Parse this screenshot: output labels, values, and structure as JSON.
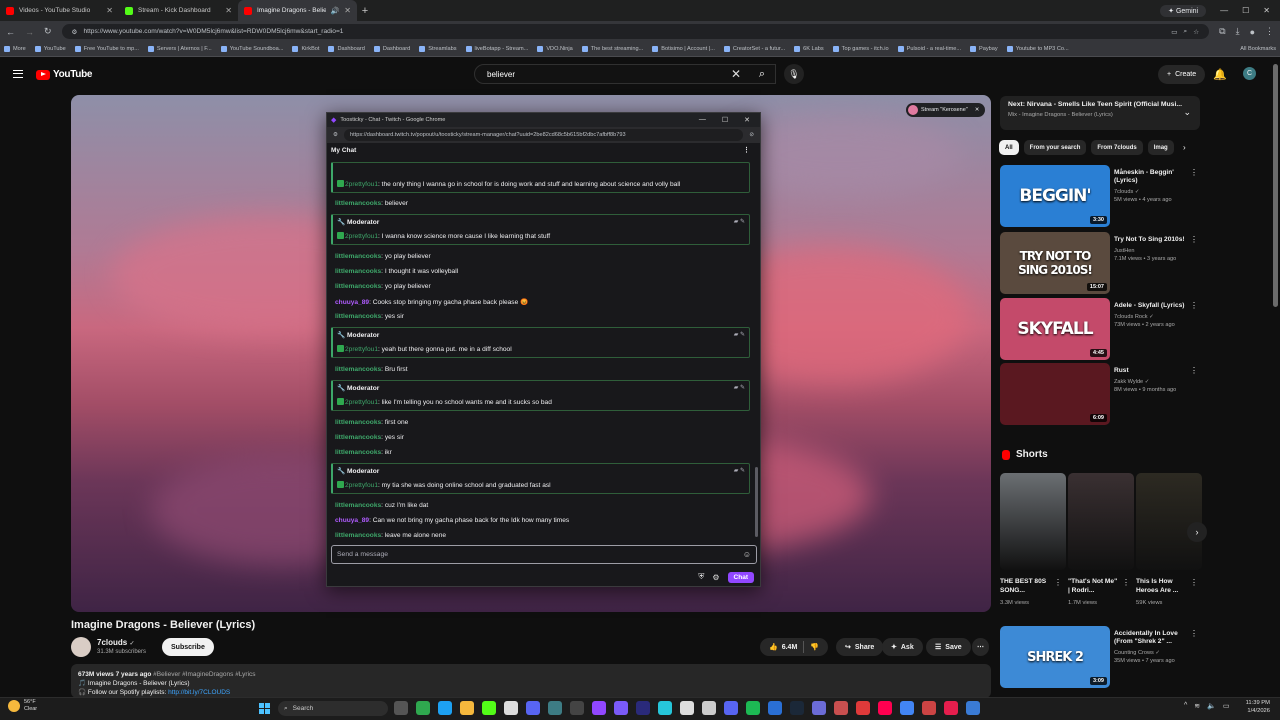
{
  "browser": {
    "tabs": [
      {
        "title": "Videos - YouTube Studio",
        "color": "#ff0000"
      },
      {
        "title": "Stream - Kick Dashboard",
        "color": "#53fc18"
      },
      {
        "title": "Imagine Dragons - Believer",
        "color": "#ff0000"
      }
    ],
    "gemini_label": "Gemini",
    "url": "https://www.youtube.com/watch?v=W0DM5lcj6mw&list=RDW0DM5lcj6mw&start_radio=1",
    "bookmarks": [
      "More",
      "YouTube",
      "Free YouTube to mp...",
      "Servers | Aternos | F...",
      "YouTube Soundboa...",
      "KirkBot",
      "Dashboard",
      "Dashboard",
      "Streamlabs",
      "liveBotapp - Stream...",
      "VDO.Ninja",
      "The best streaming...",
      "Botisimo | Account |...",
      "CreatorSet - a futur...",
      "6K Labs",
      "Top games - itch.io",
      "Pulsoid - a real-time...",
      "Paybay",
      "Youtube to MP3 Co..."
    ],
    "all_bookmarks": "All Bookmarks"
  },
  "youtube": {
    "logo": "YouTube",
    "search_value": "believer",
    "create_label": "Create",
    "avatar_letter": "C"
  },
  "stream_chip": "Stream \"Kerosene\"",
  "popup": {
    "title": "Toosticky - Chat - Twitch - Google Chrome",
    "url": "https://dashboard.twitch.tv/popout/u/toosticky/stream-manager/chat?uuid=2be82cd68c5b615bf2dbc7afbff8b793",
    "header": "My Chat",
    "mod_label": "Moderator",
    "send_placeholder": "Send a message",
    "chat_button": "Chat",
    "messages": [
      {
        "kind": "mod_cont",
        "user": "2prettyfou1",
        "text": ": the only thing I wanna go in school for is doing work and stuff and learning about science and volly ball"
      },
      {
        "kind": "msg",
        "user": "littlemancooks",
        "text": ": believer",
        "ucolor": "#3ea76a"
      },
      {
        "kind": "mod",
        "user": "2prettyfou1",
        "text": ": I wanna know science more cause I like learning that stuff"
      },
      {
        "kind": "msg",
        "user": "littlemancooks",
        "text": ": yo play believer",
        "ucolor": "#3ea76a"
      },
      {
        "kind": "msg",
        "user": "littlemancooks",
        "text": ": I thought it was volleyball",
        "ucolor": "#3ea76a"
      },
      {
        "kind": "msg",
        "user": "littlemancooks",
        "text": ": yo play believer",
        "ucolor": "#3ea76a"
      },
      {
        "kind": "msg",
        "user": "chuuya_89",
        "text": ": Cooks stop bringing my gacha phase back please 😡",
        "ucolor": "#b05cff"
      },
      {
        "kind": "msg",
        "user": "littlemancooks",
        "text": ": yes sir",
        "ucolor": "#3ea76a"
      },
      {
        "kind": "mod",
        "user": "2prettyfou1",
        "text": ": yeah but there gonna put. me in a diff school"
      },
      {
        "kind": "msg",
        "user": "littlemancooks",
        "text": ": Bru first",
        "ucolor": "#3ea76a"
      },
      {
        "kind": "mod",
        "user": "2prettyfou1",
        "text": ": like I'm telling you no school wants me and it sucks so bad"
      },
      {
        "kind": "msg",
        "user": "littlemancooks",
        "text": ": first one",
        "ucolor": "#3ea76a"
      },
      {
        "kind": "msg",
        "user": "littlemancooks",
        "text": ": yes sir",
        "ucolor": "#3ea76a"
      },
      {
        "kind": "msg",
        "user": "littlemancooks",
        "text": ": ikr",
        "ucolor": "#3ea76a"
      },
      {
        "kind": "mod",
        "user": "2prettyfou1",
        "text": ": my tia she was doing online school and graduated fast asl"
      },
      {
        "kind": "msg",
        "user": "littlemancooks",
        "text": ": cuz I'm like dat",
        "ucolor": "#3ea76a"
      },
      {
        "kind": "msg",
        "user": "chuuya_89",
        "text": ": Can we not bring my gacha phase back for the Idk how many times",
        "ucolor": "#b05cff"
      },
      {
        "kind": "msg",
        "user": "littlemancooks",
        "text": ": leave me alone nene",
        "ucolor": "#3ea76a"
      }
    ]
  },
  "video": {
    "title": "Imagine Dragons - Believer (Lyrics)",
    "channel": "7clouds",
    "subscribers": "31.3M subscribers",
    "subscribe_label": "Subscribe",
    "likes": "6.4M",
    "share_label": "Share",
    "ask_label": "Ask",
    "save_label": "Save",
    "views_line": "673M views  7 years ago",
    "tags": "#Believer #ImagineDragons #Lyrics",
    "desc_line2": "🎵 Imagine Dragons - Believer (Lyrics)",
    "desc_line3": "🎧 Follow our Spotify playlists: ",
    "desc_link": "http://bit.ly/7CLOUDS"
  },
  "sidebar": {
    "next_title": "Next: Nirvana - Smells Like Teen Spirit (Official Musi...",
    "next_sub": "Mix - Imagine Dragons - Believer (Lyrics)",
    "chips": [
      "All",
      "From your search",
      "From 7clouds",
      "Imag"
    ],
    "recs": [
      {
        "thumb_text": "BEGGIN'",
        "title": "Måneskin - Beggin' (Lyrics)",
        "channel": "7clouds ✓",
        "meta": "5M views • 4 years ago",
        "dur": "3:30",
        "bg": "#2a7fd4"
      },
      {
        "thumb_text": "TRY NOT TO SING 2010S!",
        "title": "Try Not To Sing 2010s!",
        "channel": "JustHen",
        "meta": "7.1M views • 3 years ago",
        "dur": "15:07",
        "bg": "#5a4a3e"
      },
      {
        "thumb_text": "SKYFALL",
        "title": "Adele - Skyfall (Lyrics)",
        "channel": "7clouds Rock ✓",
        "meta": "73M views • 2 years ago",
        "dur": "4:45",
        "bg": "#c44a6a"
      },
      {
        "thumb_text": "",
        "title": "Rust",
        "channel": "Zakk Wylde ✓",
        "meta": "8M views • 9 months ago",
        "dur": "6:09",
        "bg": "#5a1820"
      }
    ],
    "shorts_label": "Shorts",
    "shorts": [
      {
        "title": "THE BEST 80S SONG...",
        "views": "3.3M views",
        "bg": "#6b6f73"
      },
      {
        "title": "\"That's Not Me\" | Rodri...",
        "views": "1.7M views",
        "bg": "#3a3032"
      },
      {
        "title": "This Is How Heroes Are ...",
        "views": "59K views",
        "bg": "#2d2a22"
      }
    ],
    "last_rec": {
      "title": "Accidentally In Love (From \"Shrek 2\" ...",
      "channel": "Counting Crows ✓",
      "meta": "35M views • 7 years ago",
      "dur": "3:09",
      "thumb_text": "SHREK 2",
      "bg": "#3d8ad6"
    }
  },
  "taskbar": {
    "weather_temp": "56°F",
    "weather_cond": "Clear",
    "search_placeholder": "Search",
    "time": "11:39 PM",
    "date": "1/4/2026"
  }
}
